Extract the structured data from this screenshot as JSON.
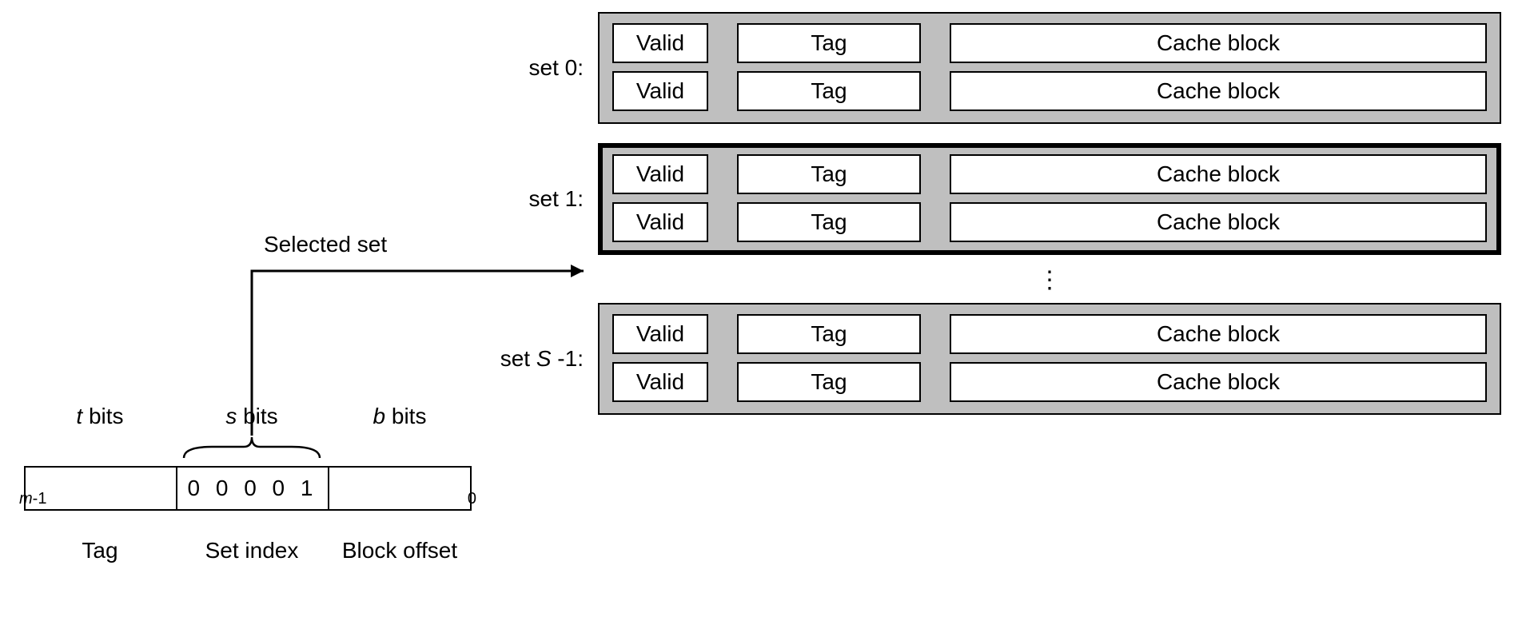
{
  "address": {
    "col_t": "t",
    "col_s": "s",
    "col_b": "b",
    "col_suffix": " bits",
    "s_value": "0 0  0 0 1",
    "end_left_var": "m",
    "end_left_suffix": "-1",
    "end_right": "0",
    "row_t": "Tag",
    "row_s": "Set index",
    "row_b": "Block offset"
  },
  "pointer_label": "Selected set",
  "sets": {
    "labels": {
      "set0": "set 0:",
      "set1": "set 1:",
      "setLast_prefix": "set ",
      "setLast_var": "S",
      "setLast_suffix": " -1:"
    },
    "cell": {
      "valid": "Valid",
      "tag": "Tag",
      "block": "Cache block"
    },
    "ellipsis": "⋮"
  }
}
